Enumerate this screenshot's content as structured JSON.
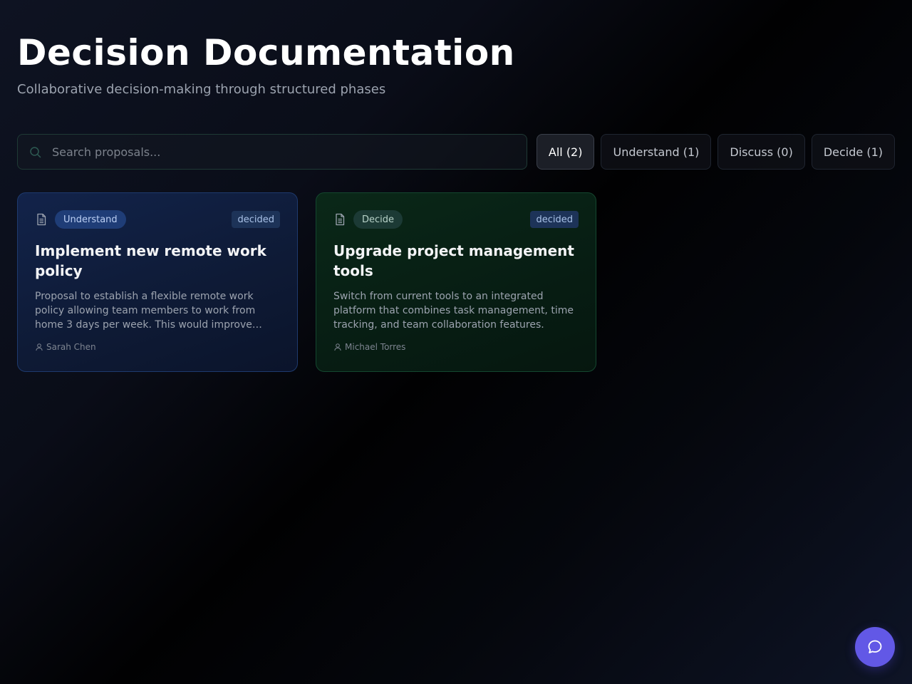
{
  "header": {
    "title": "Decision Documentation",
    "subtitle": "Collaborative decision-making through structured phases"
  },
  "search": {
    "placeholder": "Search proposals...",
    "value": ""
  },
  "filters": [
    {
      "label": "All (2)",
      "active": true
    },
    {
      "label": "Understand (1)",
      "active": false
    },
    {
      "label": "Discuss (0)",
      "active": false
    },
    {
      "label": "Decide (1)",
      "active": false
    }
  ],
  "proposals": [
    {
      "phase": "Understand",
      "status": "decided",
      "title": "Implement new remote work policy",
      "description": "Proposal to establish a flexible remote work policy allowing team members to work from home 3 days per week. This would improve employee satisfaction and reduce office costs.",
      "author": "Sarah Chen",
      "icon": "document-icon",
      "accent": "#1e3a6e"
    },
    {
      "phase": "Decide",
      "status": "decided",
      "title": "Upgrade project management tools",
      "description": "Switch from current tools to an integrated platform that combines task management, time tracking, and team collaboration features.",
      "author": "Michael Torres",
      "icon": "document-icon",
      "accent": "#14472f"
    }
  ],
  "chat_button": {
    "icon": "chat-bubble-icon",
    "color": "#6258e6"
  }
}
